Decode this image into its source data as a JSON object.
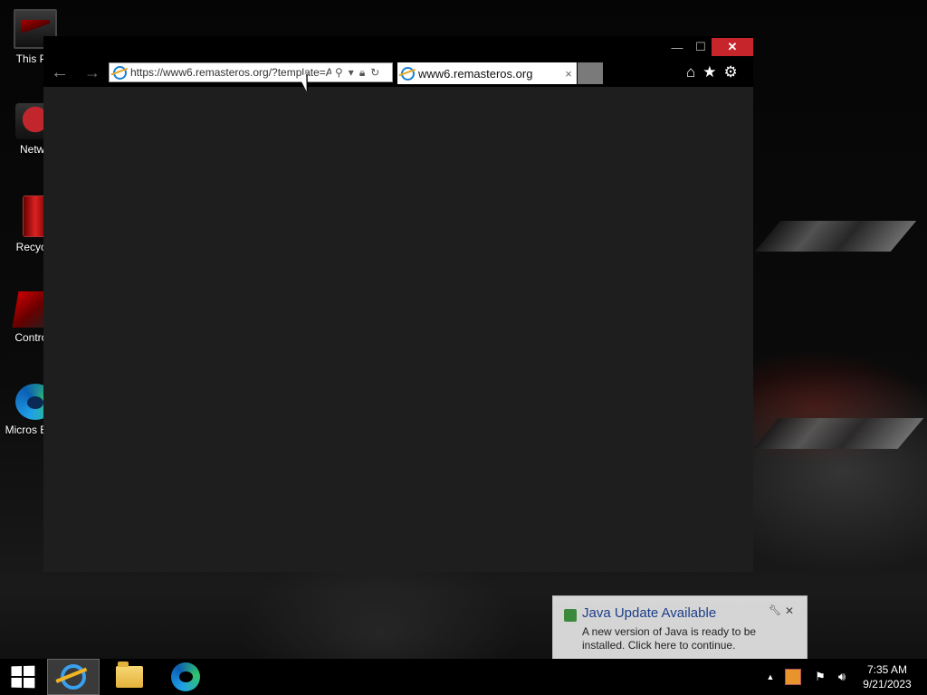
{
  "desktop": {
    "icons": [
      {
        "label": "This PC"
      },
      {
        "label": "Netwo"
      },
      {
        "label": "Recycle"
      },
      {
        "label": "Control I"
      },
      {
        "label": "Micros Edge"
      }
    ]
  },
  "browser": {
    "url": "https://www6.remasteros.org/?template=A",
    "tab_title": "www6.remasteros.org",
    "tab_close": "×",
    "window_close": "✕",
    "window_minimize": "—",
    "window_maximize": "☐",
    "back": "←",
    "forward": "→",
    "home_icon": "⌂",
    "favorites_icon": "★",
    "settings_icon": "⚙"
  },
  "notification": {
    "title": "Java Update Available",
    "body": "A new version of Java is ready to be installed. Click here to continue.",
    "close": "✕"
  },
  "taskbar": {
    "clock_time": "7:35 AM",
    "clock_date": "9/21/2023",
    "tray_up": "▲"
  },
  "colors": {
    "close_button": "#c7252c",
    "browser_content": "#1e1e1e",
    "accent_blue": "#1b7fd1"
  }
}
